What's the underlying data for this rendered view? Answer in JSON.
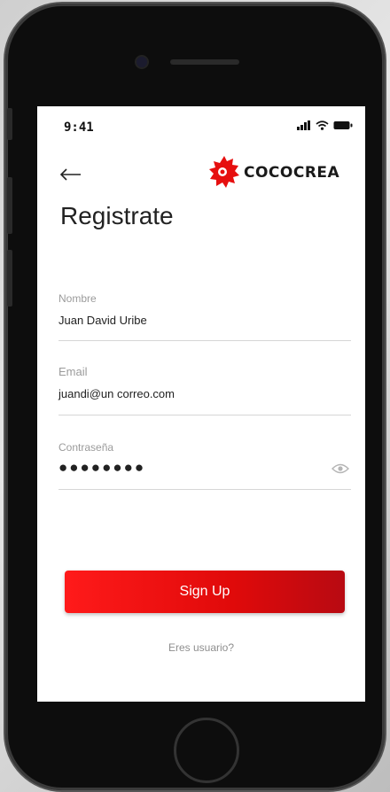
{
  "status_bar": {
    "time": "9:41"
  },
  "brand": {
    "name": "COCOCREA",
    "color": "#e60f0f"
  },
  "page": {
    "title": "Registrate"
  },
  "form": {
    "name": {
      "label": "Nombre",
      "value": "Juan David Uribe"
    },
    "email": {
      "label": "Email",
      "value": "juandi@un correo.com"
    },
    "password": {
      "label": "Contraseña",
      "value": "●●●●●●●●"
    }
  },
  "actions": {
    "signup_label": "Sign Up",
    "login_link": "Eres usuario?"
  },
  "icons": {
    "back": "arrow-left-icon",
    "visibility": "eye-icon",
    "signal": "signal-icon",
    "wifi": "wifi-icon",
    "battery": "battery-icon"
  },
  "colors": {
    "accent": "#e60f0f",
    "accent_dark": "#b80a12"
  }
}
